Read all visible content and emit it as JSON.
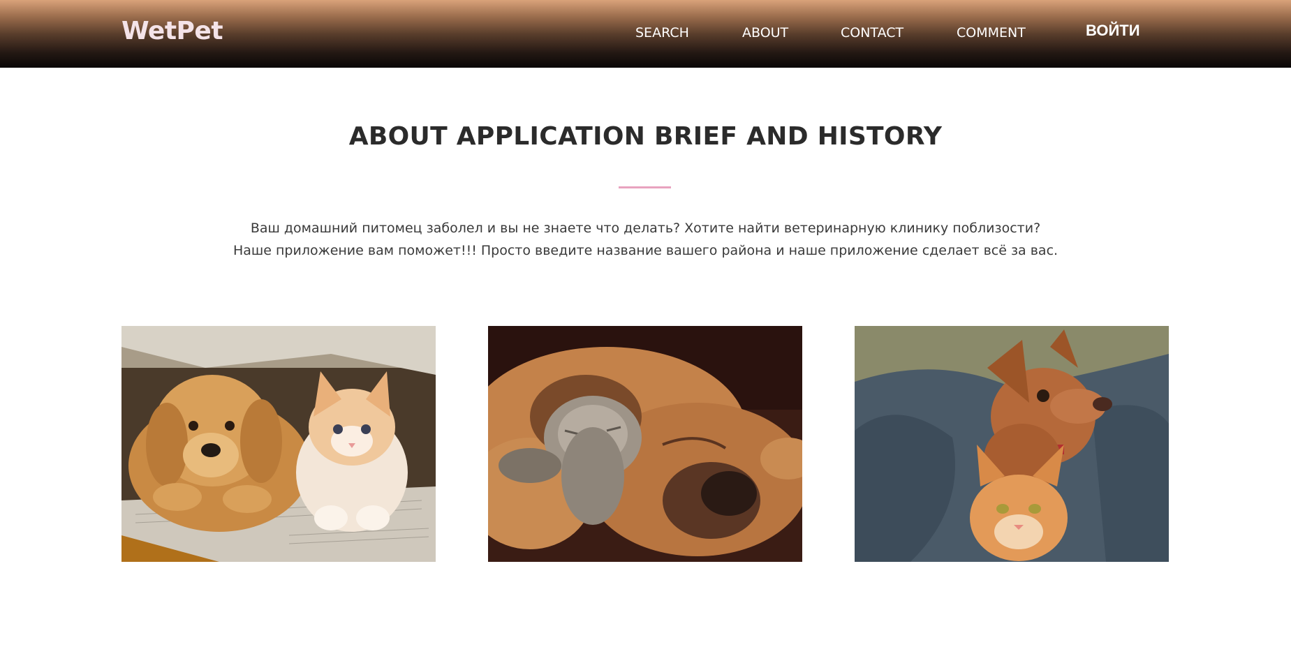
{
  "header": {
    "logo": "WetPet",
    "nav": [
      "SEARCH",
      "ABOUT",
      "CONTACT",
      "COMMENT"
    ],
    "login": "ВОЙТИ"
  },
  "about": {
    "title": "ABOUT APPLICATION BRIEF AND HISTORY",
    "description": "Ваш домашний питомец заболел и вы не знаете что делать? Хотите найти ветеринарную клинику поблизости? Наше приложение вам поможет!!! Просто введите название вашего района и наше приложение сделает всё за вас."
  },
  "colors": {
    "accent_divider": "#e8a3bf",
    "logo": "#f4e3e8",
    "header_gradient_top": "#d9a27a",
    "header_gradient_bottom": "#0a0706"
  }
}
